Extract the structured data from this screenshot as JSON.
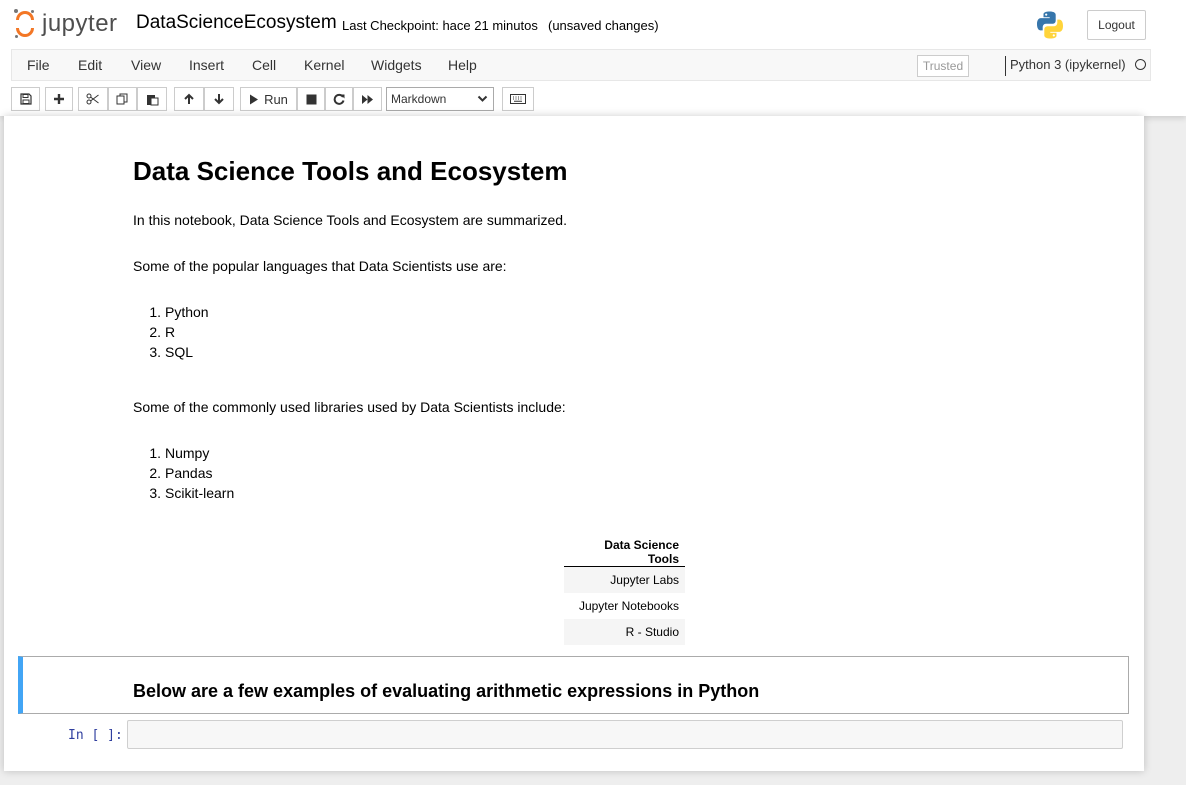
{
  "header": {
    "logo_text": "jupyter",
    "notebook_name": "DataScienceEcosystem",
    "checkpoint": "Last Checkpoint: hace 21 minutos",
    "unsaved": "(unsaved changes)",
    "logout_label": "Logout"
  },
  "menubar": {
    "items": [
      "File",
      "Edit",
      "View",
      "Insert",
      "Cell",
      "Kernel",
      "Widgets",
      "Help"
    ],
    "trusted": "Trusted",
    "kernel": "Python 3 (ipykernel)"
  },
  "toolbar": {
    "run_label": "Run",
    "cell_type": "Markdown",
    "icons": [
      "save-icon",
      "plus-icon",
      "cut-icon",
      "copy-icon",
      "paste-icon",
      "arrow-up-icon",
      "arrow-down-icon",
      "play-icon",
      "stop-icon",
      "restart-icon",
      "fast-forward-icon",
      "keyboard-icon"
    ]
  },
  "notebook": {
    "title": "Data Science Tools and Ecosystem",
    "intro": "In this notebook, Data Science Tools and Ecosystem are summarized.",
    "languages_intro": "Some of the popular languages that Data Scientists use are:",
    "languages": [
      "Python",
      "R",
      "SQL"
    ],
    "libraries_intro": "Some of the commonly used libraries used by Data Scientists include:",
    "libraries": [
      "Numpy",
      "Pandas",
      "Scikit-learn"
    ],
    "table": {
      "header": "Data Science Tools",
      "rows": [
        "Jupyter Labs",
        "Jupyter Notebooks",
        "R - Studio"
      ]
    },
    "selected_cell_heading": "Below are a few examples of evaluating arithmetic expressions in Python",
    "code_prompt": "In [ ]:",
    "code_value": ""
  },
  "colors": {
    "accent": "#42a5f5",
    "jupyter_orange": "#f37726",
    "prompt": "#303f9f"
  }
}
